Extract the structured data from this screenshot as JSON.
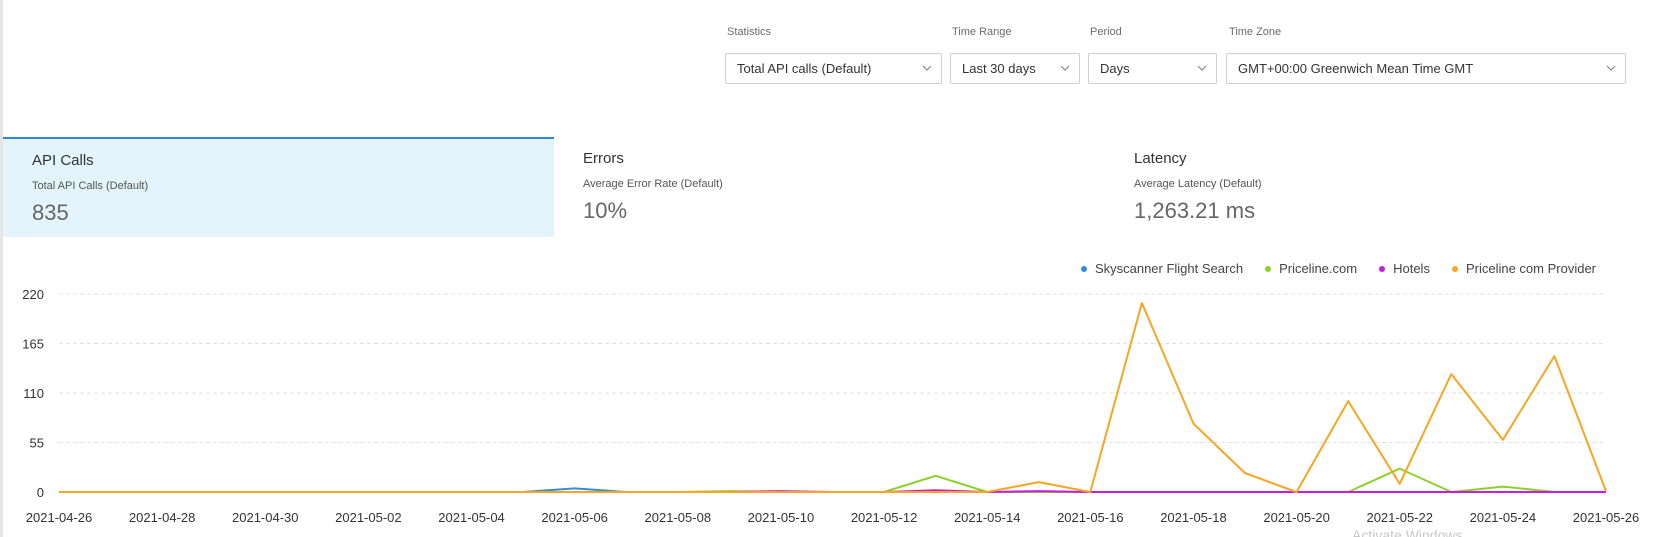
{
  "filters": {
    "statistics": {
      "label": "Statistics",
      "value": "Total API calls (Default)"
    },
    "time_range": {
      "label": "Time Range",
      "value": "Last 30 days"
    },
    "period": {
      "label": "Period",
      "value": "Days"
    },
    "time_zone": {
      "label": "Time Zone",
      "value": "GMT+00:00 Greenwich Mean Time GMT"
    }
  },
  "kpis": [
    {
      "title": "API Calls",
      "subtitle": "Total API Calls (Default)",
      "value": "835",
      "active": true
    },
    {
      "title": "Errors",
      "subtitle": "Average Error Rate (Default)",
      "value": "10%",
      "active": false
    },
    {
      "title": "Latency",
      "subtitle": "Average Latency (Default)",
      "value": "1,263.21 ms",
      "active": false
    }
  ],
  "watermark": "Activate Windows",
  "chart_data": {
    "type": "line",
    "x": [
      "2021-04-26",
      "2021-04-27",
      "2021-04-28",
      "2021-04-29",
      "2021-04-30",
      "2021-05-01",
      "2021-05-02",
      "2021-05-03",
      "2021-05-04",
      "2021-05-05",
      "2021-05-06",
      "2021-05-07",
      "2021-05-08",
      "2021-05-09",
      "2021-05-10",
      "2021-05-11",
      "2021-05-12",
      "2021-05-13",
      "2021-05-14",
      "2021-05-15",
      "2021-05-16",
      "2021-05-17",
      "2021-05-18",
      "2021-05-19",
      "2021-05-20",
      "2021-05-21",
      "2021-05-22",
      "2021-05-23",
      "2021-05-24",
      "2021-05-25",
      "2021-05-26"
    ],
    "x_tick_labels": [
      "2021-04-26",
      "2021-04-28",
      "2021-04-30",
      "2021-05-02",
      "2021-05-04",
      "2021-05-06",
      "2021-05-08",
      "2021-05-10",
      "2021-05-12",
      "2021-05-14",
      "2021-05-16",
      "2021-05-18",
      "2021-05-20",
      "2021-05-22",
      "2021-05-24",
      "2021-05-26"
    ],
    "y_ticks": [
      0,
      55,
      110,
      165,
      220
    ],
    "ylim": [
      0,
      220
    ],
    "grid": true,
    "legend_position": "top-right",
    "series": [
      {
        "name": "Skyscanner Flight Search",
        "color": "#2f8fdd",
        "values": [
          0,
          0,
          0,
          0,
          0,
          0,
          0,
          0,
          0,
          0,
          4,
          0,
          0,
          0,
          0,
          0,
          0,
          0,
          0,
          0,
          0,
          0,
          0,
          0,
          0,
          0,
          0,
          0,
          0,
          0,
          0
        ]
      },
      {
        "name": "Priceline.com",
        "color": "#8cd12a",
        "values": [
          0,
          0,
          0,
          0,
          0,
          0,
          0,
          0,
          0,
          0,
          0,
          0,
          0,
          1,
          0,
          0,
          0,
          18,
          0,
          0,
          0,
          0,
          0,
          0,
          0,
          0,
          26,
          0,
          6,
          0,
          0
        ]
      },
      {
        "name": "Hotels",
        "color": "#c51ee2",
        "values": [
          0,
          0,
          0,
          0,
          0,
          0,
          0,
          0,
          0,
          0,
          0,
          0,
          0,
          0,
          1,
          0,
          0,
          2,
          0,
          1,
          0,
          0,
          0,
          0,
          0,
          0,
          0,
          0,
          0,
          0,
          0
        ]
      },
      {
        "name": "Priceline com Provider",
        "color": "#f5a623",
        "values": [
          0,
          0,
          0,
          0,
          0,
          0,
          0,
          0,
          0,
          0,
          0,
          0,
          0,
          0,
          0,
          0,
          0,
          0,
          0,
          11,
          0,
          210,
          76,
          21,
          0,
          101,
          9,
          131,
          58,
          151,
          1
        ]
      }
    ]
  }
}
